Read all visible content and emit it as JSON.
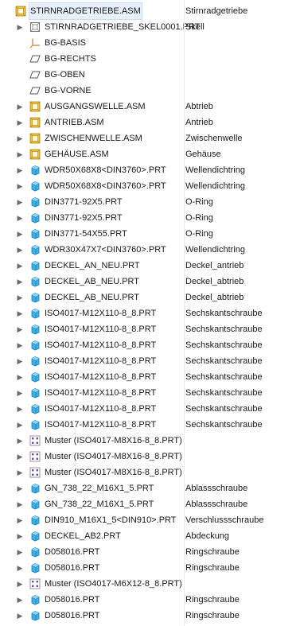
{
  "tree": {
    "rows": [
      {
        "name": "STIRNRADGETRIEBE.ASM",
        "desc": "Stirnradgetriebe",
        "icon": "assembly-icon",
        "expander": false,
        "level": 0,
        "selected": true
      },
      {
        "name": "STIRNRADGETRIEBE_SKEL0001.PRT",
        "desc": "Skell",
        "icon": "skeleton-part-icon",
        "expander": true,
        "level": 1
      },
      {
        "name": "BG-BASIS",
        "desc": "",
        "icon": "coordinate-system-icon",
        "expander": false,
        "level": 1
      },
      {
        "name": "BG-RECHTS",
        "desc": "",
        "icon": "datum-plane-icon",
        "expander": false,
        "level": 1
      },
      {
        "name": "BG-OBEN",
        "desc": "",
        "icon": "datum-plane-icon",
        "expander": false,
        "level": 1
      },
      {
        "name": "BG-VORNE",
        "desc": "",
        "icon": "datum-plane-icon",
        "expander": false,
        "level": 1
      },
      {
        "name": "AUSGANGSWELLE.ASM",
        "desc": "Abtrieb",
        "icon": "assembly-icon",
        "expander": true,
        "level": 1
      },
      {
        "name": "ANTRIEB.ASM",
        "desc": "Antrieb",
        "icon": "assembly-icon",
        "expander": true,
        "level": 1
      },
      {
        "name": "ZWISCHENWELLE.ASM",
        "desc": "Zwischenwelle",
        "icon": "assembly-icon",
        "expander": true,
        "level": 1
      },
      {
        "name": "GEHÄUSE.ASM",
        "desc": "Gehäuse",
        "icon": "assembly-icon",
        "expander": true,
        "level": 1
      },
      {
        "name": "WDR50X68X8<DIN3760>.PRT",
        "desc": "Wellendichtring",
        "icon": "part-icon",
        "expander": true,
        "level": 1
      },
      {
        "name": "WDR50X68X8<DIN3760>.PRT",
        "desc": "Wellendichtring",
        "icon": "part-icon",
        "expander": true,
        "level": 1
      },
      {
        "name": "DIN3771-92X5.PRT",
        "desc": "O-Ring",
        "icon": "part-icon",
        "expander": true,
        "level": 1
      },
      {
        "name": "DIN3771-92X5.PRT",
        "desc": "O-Ring",
        "icon": "part-icon",
        "expander": true,
        "level": 1
      },
      {
        "name": "DIN3771-54X55.PRT",
        "desc": "O-Ring",
        "icon": "part-icon",
        "expander": true,
        "level": 1
      },
      {
        "name": "WDR30X47X7<DIN3760>.PRT",
        "desc": "Wellendichtring",
        "icon": "part-icon",
        "expander": true,
        "level": 1
      },
      {
        "name": "DECKEL_AN_NEU.PRT",
        "desc": "Deckel_antrieb",
        "icon": "part-icon",
        "expander": true,
        "level": 1
      },
      {
        "name": "DECKEL_AB_NEU.PRT",
        "desc": "Deckel_abtrieb",
        "icon": "part-icon",
        "expander": true,
        "level": 1
      },
      {
        "name": "DECKEL_AB_NEU.PRT",
        "desc": "Deckel_abtrieb",
        "icon": "part-icon",
        "expander": true,
        "level": 1
      },
      {
        "name": "ISO4017-M12X110-8_8.PRT",
        "desc": "Sechskantschraube",
        "icon": "part-icon",
        "expander": true,
        "level": 1
      },
      {
        "name": "ISO4017-M12X110-8_8.PRT",
        "desc": "Sechskantschraube",
        "icon": "part-icon",
        "expander": true,
        "level": 1
      },
      {
        "name": "ISO4017-M12X110-8_8.PRT",
        "desc": "Sechskantschraube",
        "icon": "part-icon",
        "expander": true,
        "level": 1
      },
      {
        "name": "ISO4017-M12X110-8_8.PRT",
        "desc": "Sechskantschraube",
        "icon": "part-icon",
        "expander": true,
        "level": 1
      },
      {
        "name": "ISO4017-M12X110-8_8.PRT",
        "desc": "Sechskantschraube",
        "icon": "part-icon",
        "expander": true,
        "level": 1
      },
      {
        "name": "ISO4017-M12X110-8_8.PRT",
        "desc": "Sechskantschraube",
        "icon": "part-icon",
        "expander": true,
        "level": 1
      },
      {
        "name": "ISO4017-M12X110-8_8.PRT",
        "desc": "Sechskantschraube",
        "icon": "part-icon",
        "expander": true,
        "level": 1
      },
      {
        "name": "ISO4017-M12X110-8_8.PRT",
        "desc": "Sechskantschraube",
        "icon": "part-icon",
        "expander": true,
        "level": 1
      },
      {
        "name": "Muster (ISO4017-M8X16-8_8.PRT)",
        "desc": "",
        "icon": "pattern-icon",
        "expander": true,
        "level": 1
      },
      {
        "name": "Muster (ISO4017-M8X16-8_8.PRT)",
        "desc": "",
        "icon": "pattern-icon",
        "expander": true,
        "level": 1
      },
      {
        "name": "Muster (ISO4017-M8X16-8_8.PRT)",
        "desc": "",
        "icon": "pattern-icon",
        "expander": true,
        "level": 1
      },
      {
        "name": "GN_738_22_M16X1_5.PRT",
        "desc": "Ablassschraube",
        "icon": "part-icon",
        "expander": true,
        "level": 1
      },
      {
        "name": "GN_738_22_M16X1_5.PRT",
        "desc": "Ablassschraube",
        "icon": "part-icon",
        "expander": true,
        "level": 1
      },
      {
        "name": "DIN910_M16X1_5<DIN910>.PRT",
        "desc": "Verschlussschraube",
        "icon": "part-icon",
        "expander": true,
        "level": 1
      },
      {
        "name": "DECKEL_AB2.PRT",
        "desc": "Abdeckung",
        "icon": "part-icon",
        "expander": true,
        "level": 1
      },
      {
        "name": "D058016.PRT",
        "desc": "Ringschraube",
        "icon": "part-icon",
        "expander": true,
        "level": 1
      },
      {
        "name": "D058016.PRT",
        "desc": "Ringschraube",
        "icon": "part-icon",
        "expander": true,
        "level": 1
      },
      {
        "name": "Muster (ISO4017-M6X12-8_8.PRT)",
        "desc": "",
        "icon": "pattern-icon",
        "expander": true,
        "level": 1
      },
      {
        "name": "D058016.PRT",
        "desc": "Ringschraube",
        "icon": "part-icon",
        "expander": true,
        "level": 1
      },
      {
        "name": "D058016.PRT",
        "desc": "Ringschraube",
        "icon": "part-icon",
        "expander": true,
        "level": 1
      }
    ]
  },
  "colors": {
    "part_fill": "#3fb0e6",
    "part_edge": "#1a7fb8",
    "assembly_fill": "#f0c040",
    "assembly_edge": "#b08510",
    "selection_bg": "#e8f1fb"
  }
}
